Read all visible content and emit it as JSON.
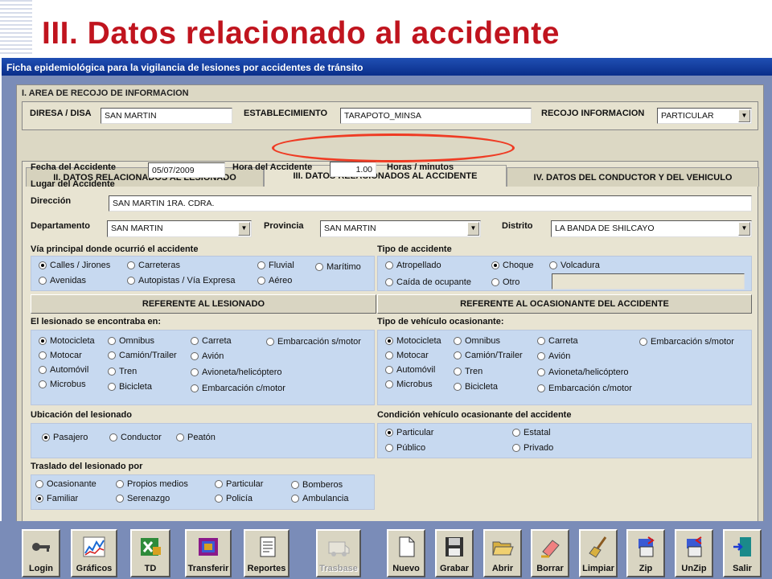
{
  "slide": {
    "title": "III. Datos relacionado al accidente"
  },
  "window": {
    "title": "Ficha epidemiológica para la vigilancia de lesiones por accidentes de tránsito"
  },
  "section1": {
    "title": "I. AREA DE RECOJO DE INFORMACION",
    "diresa_label": "DIRESA / DISA",
    "diresa_value": "SAN MARTIN",
    "estab_label": "ESTABLECIMIENTO",
    "estab_value": "TARAPOTO_MINSA",
    "recojo_label": "RECOJO INFORMACION",
    "recojo_value": "PARTICULAR"
  },
  "tabs": [
    {
      "label": "II. DATOS RELACIONADOS AL LESIONADO"
    },
    {
      "label": "III. DATOS RELACIONADOS AL ACCIDENTE"
    },
    {
      "label": "IV. DATOS DEL CONDUCTOR Y DEL VEHICULO"
    }
  ],
  "accident": {
    "fecha_label": "Fecha del Accidente",
    "fecha_value": "05/07/2009",
    "hora_label": "Hora del Accidente",
    "hora_value": "1.00",
    "hora_unit": "Horas / minutos",
    "lugar_label": "Lugar del Accidente",
    "direccion_label": "Dirección",
    "direccion_value": "SAN MARTIN 1RA. CDRA.",
    "depto_label": "Departamento",
    "depto_value": "SAN MARTIN",
    "prov_label": "Provincia",
    "prov_value": "SAN MARTIN",
    "distrito_label": "Distrito",
    "distrito_value": "LA BANDA DE SHILCAYO"
  },
  "via": {
    "title": "Vía principal donde ocurrió el accidente",
    "options": [
      "Calles / Jirones",
      "Carreteras",
      "Fluvial",
      "Marítimo",
      "Avenidas",
      "Autopistas / Vía Expresa",
      "Aéreo"
    ],
    "selected": 0
  },
  "tipo_accidente": {
    "title": "Tipo de accidente",
    "options": [
      "Atropellado",
      "Choque",
      "Volcadura",
      "Caída de ocupante",
      "Otro"
    ],
    "selected": 1
  },
  "headers": {
    "left": "REFERENTE AL LESIONADO",
    "right": "REFERENTE AL OCASIONANTE DEL ACCIDENTE"
  },
  "lesionado": {
    "title": "El lesionado se encontraba en:",
    "options": [
      "Motocicleta",
      "Omnibus",
      "Carreta",
      "Embarcación s/motor",
      "Motocar",
      "Camión/Trailer",
      "Avión",
      "Automóvil",
      "Tren",
      "Avioneta/helicóptero",
      "Microbus",
      "Bicicleta",
      "Embarcación c/motor"
    ],
    "selected": 0
  },
  "ocasionante": {
    "title": "Tipo de vehículo ocasionante:",
    "options": [
      "Motocicleta",
      "Omnibus",
      "Carreta",
      "Embarcación s/motor",
      "Motocar",
      "Camión/Trailer",
      "Avión",
      "Automóvil",
      "Tren",
      "Avioneta/helicóptero",
      "Microbus",
      "Bicicleta",
      "Embarcación c/motor"
    ],
    "selected": 0
  },
  "ubicacion": {
    "title": "Ubicación del lesionado",
    "options": [
      "Pasajero",
      "Conductor",
      "Peatón"
    ],
    "selected": 0
  },
  "condicion": {
    "title": "Condición vehículo ocasionante del accidente",
    "options": [
      "Particular",
      "Estatal",
      "Público",
      "Privado"
    ],
    "selected": 0
  },
  "traslado": {
    "title": "Traslado del lesionado por",
    "options": [
      "Ocasionante",
      "Propios medios",
      "Particular",
      "Bomberos",
      "Familiar",
      "Serenazgo",
      "Policía",
      "Ambulancia"
    ],
    "selected": 4
  },
  "toolbar": [
    {
      "label": "Login",
      "icon": "key-icon"
    },
    {
      "label": "Gráficos",
      "icon": "chart-icon"
    },
    {
      "label": "TD",
      "icon": "spreadsheet-icon"
    },
    {
      "label": "Transferir",
      "icon": "transfer-icon"
    },
    {
      "label": "Reportes",
      "icon": "report-icon"
    },
    {
      "label": "Trasbase",
      "icon": "ambulance-icon"
    },
    {
      "label": "Nuevo",
      "icon": "new-document-icon"
    },
    {
      "label": "Grabar",
      "icon": "floppy-disk-icon"
    },
    {
      "label": "Abrir",
      "icon": "open-folder-icon"
    },
    {
      "label": "Borrar",
      "icon": "eraser-icon"
    },
    {
      "label": "Limpiar",
      "icon": "broom-icon"
    },
    {
      "label": "Zip",
      "icon": "zip-icon"
    },
    {
      "label": "UnZip",
      "icon": "unzip-icon"
    },
    {
      "label": "Salir",
      "icon": "exit-door-icon"
    }
  ]
}
